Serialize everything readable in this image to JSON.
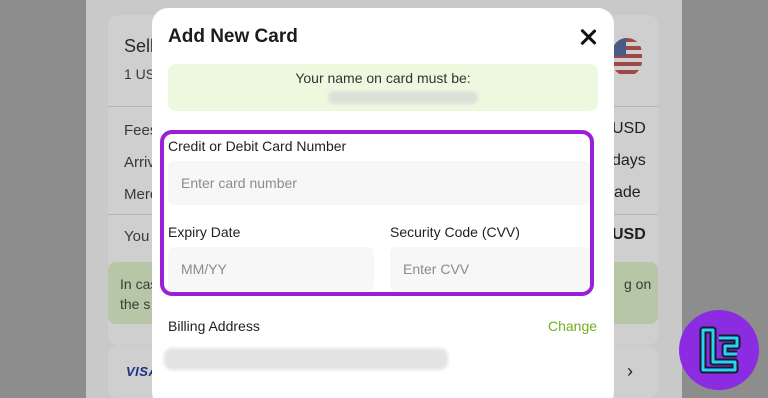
{
  "background": {
    "card_title": "Sell",
    "card_subtitle": "1 US",
    "fees_label": "Fees",
    "fees_value": "USD",
    "arrival_label": "Arriv",
    "arrival_value": "days",
    "merchant_label": "Merc",
    "merchant_value": "ade",
    "you_label": "You",
    "you_value": "USD",
    "notice_line1_left": "In cas",
    "notice_line1_right": "g on",
    "notice_line2_left": "the s",
    "card_brand": "VISA"
  },
  "modal": {
    "title": "Add New Card",
    "name_notice": "Your name on card must be:",
    "card_number_label": "Credit or Debit Card Number",
    "card_number_placeholder": "Enter card number",
    "expiry_label": "Expiry Date",
    "expiry_placeholder": "MM/YY",
    "cvv_label": "Security Code (CVV)",
    "cvv_placeholder": "Enter CVV",
    "billing_label": "Billing Address",
    "change_label": "Change"
  },
  "colors": {
    "highlight": "#9b1ed9",
    "accent_link": "#6fb11d",
    "notice_bg": "#eef8df",
    "logo_bg": "#8b2be2"
  },
  "icons": {
    "close": "close-icon",
    "flag": "us-flag-icon",
    "chevron": "chevron-right-icon",
    "logo": "brand-logo-icon"
  }
}
